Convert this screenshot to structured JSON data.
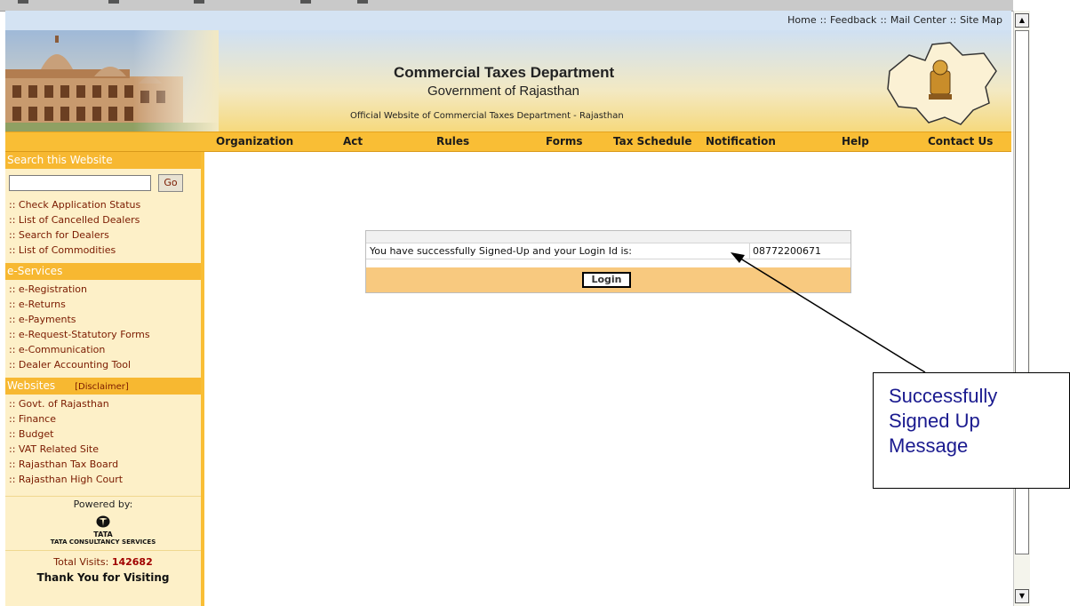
{
  "top_links": [
    "Home",
    "Feedback",
    "Mail Center",
    "Site Map"
  ],
  "top_sep": "::",
  "banner": {
    "title": "Commercial Taxes Department",
    "subtitle": "Government of Rajasthan",
    "tagline": "Official Website of Commercial Taxes Department - Rajasthan"
  },
  "nav": [
    "Organization",
    "Act",
    "Rules",
    "Forms",
    "Tax Schedule",
    "Notification",
    "Help",
    "Contact Us"
  ],
  "sidebar": {
    "search_heading": "Search this Website",
    "search_value": "",
    "go_label": "Go",
    "links1": [
      ":: Check Application Status",
      ":: List of Cancelled Dealers",
      ":: Search for Dealers",
      ":: List of Commodities"
    ],
    "eservices_heading": "e-Services",
    "links2": [
      ":: e-Registration",
      ":: e-Returns",
      ":: e-Payments",
      ":: e-Request-Statutory Forms",
      ":: e-Communication",
      ":: Dealer Accounting Tool"
    ],
    "websites_heading": "Websites",
    "disclaimer": "[Disclaimer]",
    "links3": [
      ":: Govt. of Rajasthan",
      ":: Finance",
      ":: Budget",
      ":: VAT Related Site",
      ":: Rajasthan Tax Board",
      ":: Rajasthan High Court"
    ],
    "powered_by": "Powered by:",
    "tata": "TATA",
    "tcs": "TATA CONSULTANCY SERVICES",
    "visits_label": "Total Visits:",
    "visits_count": "142682",
    "thanks": "Thank You for Visiting"
  },
  "message": {
    "text": "You have successfully Signed-Up and your Login Id is:",
    "login_id": "08772200671",
    "login_label": "Login"
  },
  "callout": {
    "lines": [
      "Successfully",
      "Signed Up",
      "Message"
    ]
  },
  "colors": {
    "nav_bar": "#f9be35",
    "sidebar_bg": "#fdf0c8",
    "link": "#7a1a00",
    "login_row": "#f8c97f",
    "callout_text": "#1a1a8f"
  },
  "icons": [
    "scroll-up-icon",
    "scroll-down-icon",
    "tata-logo-icon",
    "state-emblem-icon"
  ]
}
